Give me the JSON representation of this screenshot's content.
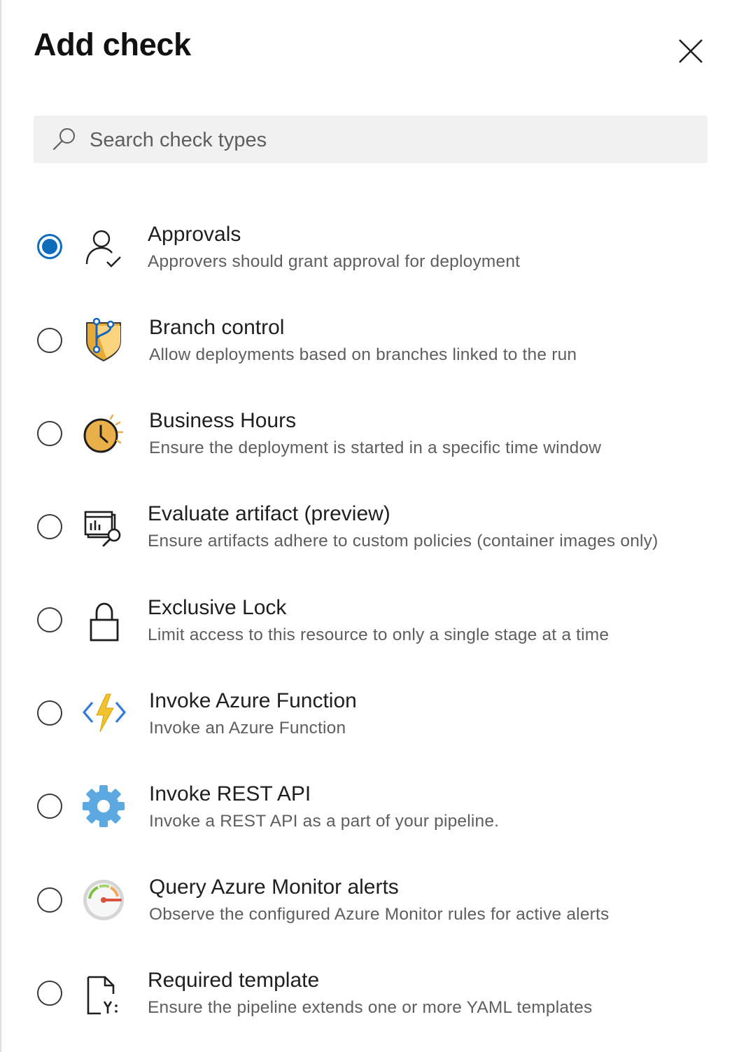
{
  "panel": {
    "title": "Add check",
    "search_placeholder": "Search check types"
  },
  "checks": [
    {
      "name": "Approvals",
      "description": "Approvers should grant approval for deployment",
      "icon": "approvals-person-check-icon",
      "selected": true
    },
    {
      "name": "Branch control",
      "description": "Allow deployments based on branches linked to the run",
      "icon": "branch-shield-icon",
      "selected": false
    },
    {
      "name": "Business Hours",
      "description": "Ensure the deployment is started in a specific time window",
      "icon": "clock-sun-icon",
      "selected": false
    },
    {
      "name": "Evaluate artifact (preview)",
      "description": "Ensure artifacts adhere to custom policies (container images only)",
      "icon": "artifact-search-icon",
      "selected": false
    },
    {
      "name": "Exclusive Lock",
      "description": "Limit access to this resource to only a single stage at a time",
      "icon": "lock-icon",
      "selected": false
    },
    {
      "name": "Invoke Azure Function",
      "description": "Invoke an Azure Function",
      "icon": "azure-function-icon",
      "selected": false
    },
    {
      "name": "Invoke REST API",
      "description": "Invoke a REST API as a part of your pipeline.",
      "icon": "gear-icon",
      "selected": false
    },
    {
      "name": "Query Azure Monitor alerts",
      "description": "Observe the configured Azure Monitor rules for active alerts",
      "icon": "monitor-gauge-icon",
      "selected": false
    },
    {
      "name": "Required template",
      "description": "Ensure the pipeline extends one or more YAML templates",
      "icon": "yaml-template-icon",
      "selected": false
    }
  ],
  "colors": {
    "accent": "#0f6cbd",
    "search_bg": "#f1f1f1",
    "secondary_text": "#605e5c"
  }
}
